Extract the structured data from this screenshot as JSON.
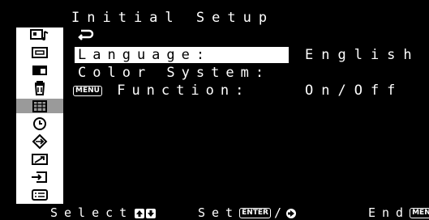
{
  "title": "Initial Setup",
  "menu": {
    "rows": [
      {
        "label": "Language:",
        "value": "English",
        "selected": true
      },
      {
        "label": "Color System:",
        "value": ""
      },
      {
        "label": "Function:",
        "value": "On/Off",
        "tag": "MENU"
      }
    ]
  },
  "sidebar": {
    "icons": [
      "picture-sound-icon",
      "screen-icon",
      "pip-icon",
      "trash-can-icon",
      "setup-icon",
      "clock-icon",
      "input-arrow-icon",
      "trend-icon",
      "input-select-icon",
      "list-icon"
    ],
    "selected_index": 4
  },
  "footer": {
    "select_label": "Select",
    "set_label": "Set",
    "enter_tag": "ENTER",
    "slash": "/",
    "end_label": "End",
    "menu_tag": "MENU"
  },
  "colors": {
    "background": "#000000",
    "text": "#ffffff",
    "sidebar": "#ffffff",
    "highlight": "#ffffff",
    "sidebar_selected": "#9a9a9a"
  }
}
